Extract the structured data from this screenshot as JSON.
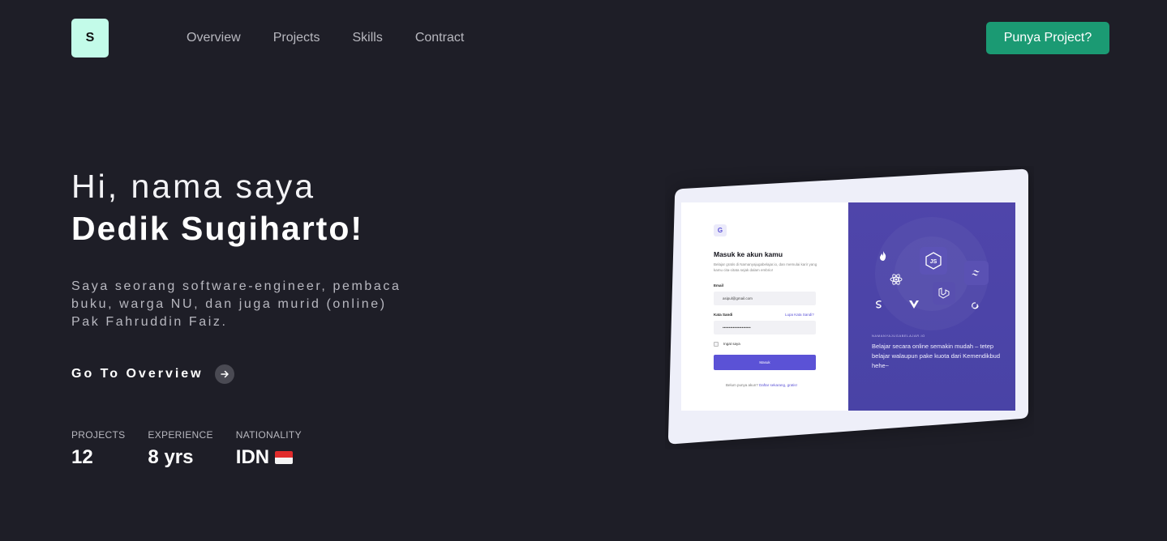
{
  "header": {
    "logo_letter": "S",
    "nav": [
      "Overview",
      "Projects",
      "Skills",
      "Contract"
    ],
    "cta_label": "Punya Project?",
    "cta_color": "#1b9a73"
  },
  "hero": {
    "greeting": "Hi, nama saya",
    "name": "Dedik Sugiharto!",
    "bio": "Saya seorang software-engineer, pembaca buku, warga NU, dan juga murid (online) Pak Fahruddin Faiz.",
    "overview_link": "Go To Overview",
    "overview_icon": "arrow-right-icon"
  },
  "stats": [
    {
      "label": "PROJECTS",
      "value": "12"
    },
    {
      "label": "EXPERIENCE",
      "value": "8 yrs"
    },
    {
      "label": "NATIONALITY",
      "value": "IDN",
      "icon": "indonesia-flag-icon"
    }
  ],
  "mockup": {
    "logo_letter": "G",
    "title": "Masuk ke akun kamu",
    "subtitle": "Belajar gratis di Namanyajugabelajar.io, dan memulai karir yang kamu cita-citata sejak dalam embrio!",
    "email_label": "Email",
    "email_value": "asipul@gmail.com",
    "password_label": "Kata Sandi",
    "forgot_label": "Lupa Kata Sandi?",
    "password_value": "••••••••••••••••••••••",
    "remember_label": "Ingat saya",
    "submit_label": "Masuk",
    "register_text": "Belum punya akun?",
    "register_link": "Daftar sekarang, gratis!",
    "side_tag": "NAMANYAJUGABELAJAR.IO",
    "side_text": "Belajar secara online semakin mudah – tetep belajar walaupun pake kuota dari Kemendikbud hehe~",
    "accent_color": "#5b52d6",
    "panel_color": "#4f45aa",
    "tech_icons": [
      "firebase-icon",
      "nodejs-icon",
      "tailwind-icon",
      "react-icon",
      "laravel-icon",
      "vue-icon",
      "sass-icon",
      "redux-icon"
    ]
  }
}
